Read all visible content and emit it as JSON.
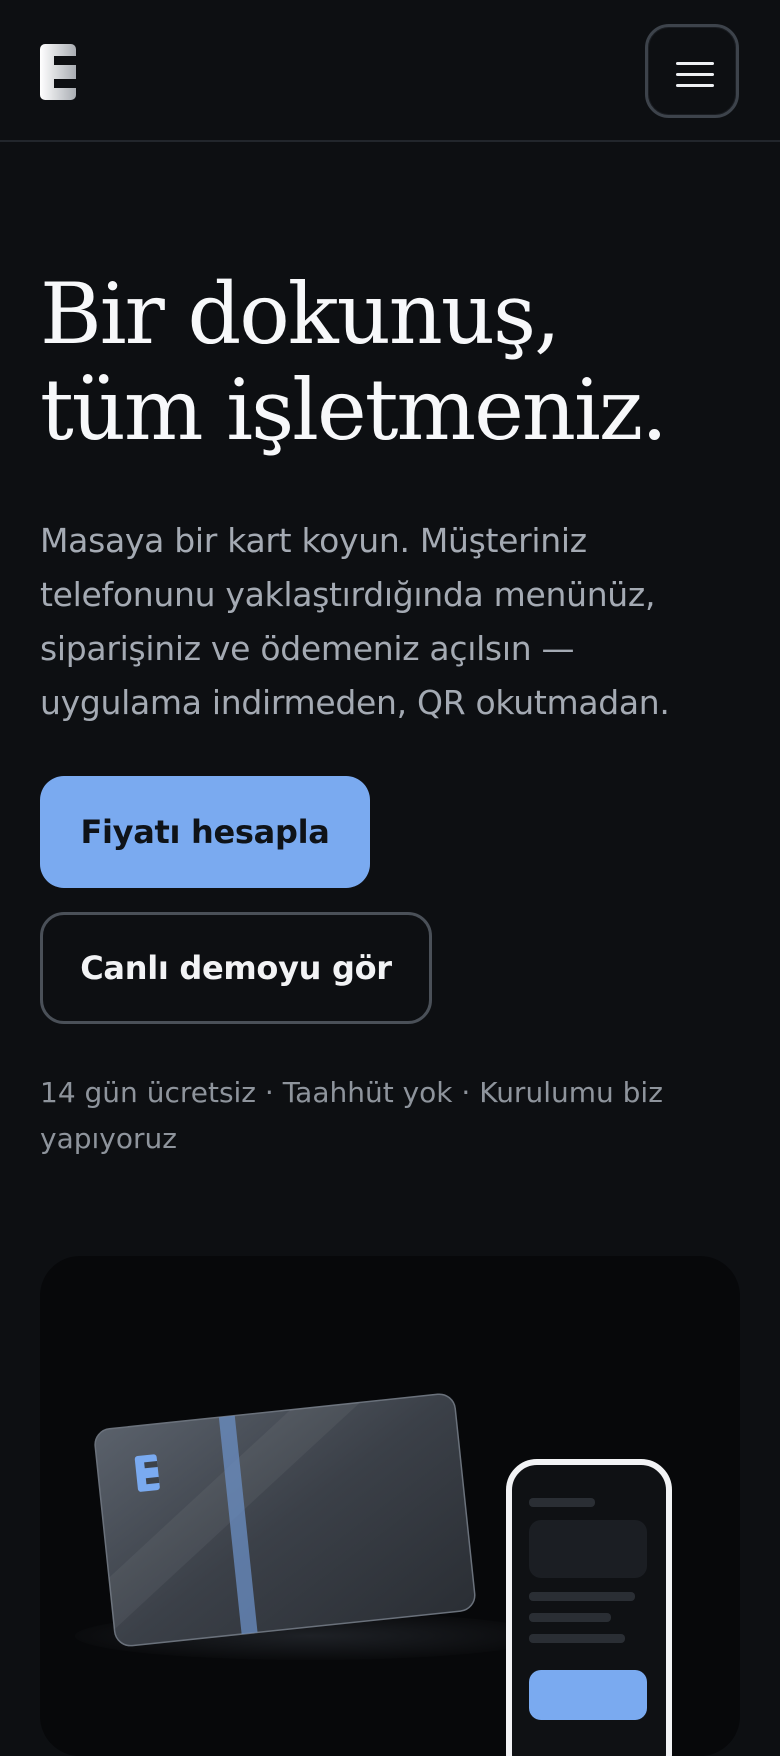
{
  "header": {
    "logo_icon": "brand-e-logo-icon",
    "menu_icon": "hamburger-menu-icon"
  },
  "hero": {
    "title_line1": "Bir dokunuş,",
    "title_line2": "tüm işletmeniz.",
    "subtitle": "Masaya bir kart koyun. Müşteriniz telefonunu yaklaştırdığında menünüz, siparişiniz ve ödemeniz açılsın — uygulama indirmeden, QR okutmadan.",
    "primary_cta": "Fiyatı hesapla",
    "secondary_cta": "Canlı demoyu gör",
    "trust_line": "14 gün ücretsiz · Taahhüt yok · Kurulumu biz yapıyoruz"
  },
  "showcase": {
    "card_icon": "nfc-card-illustration",
    "phone_icon": "phone-illustration"
  },
  "colors": {
    "background": "#0d0f12",
    "accent": "#7aaaf0",
    "text": "#f2f3f5",
    "muted": "#a4aab3"
  }
}
